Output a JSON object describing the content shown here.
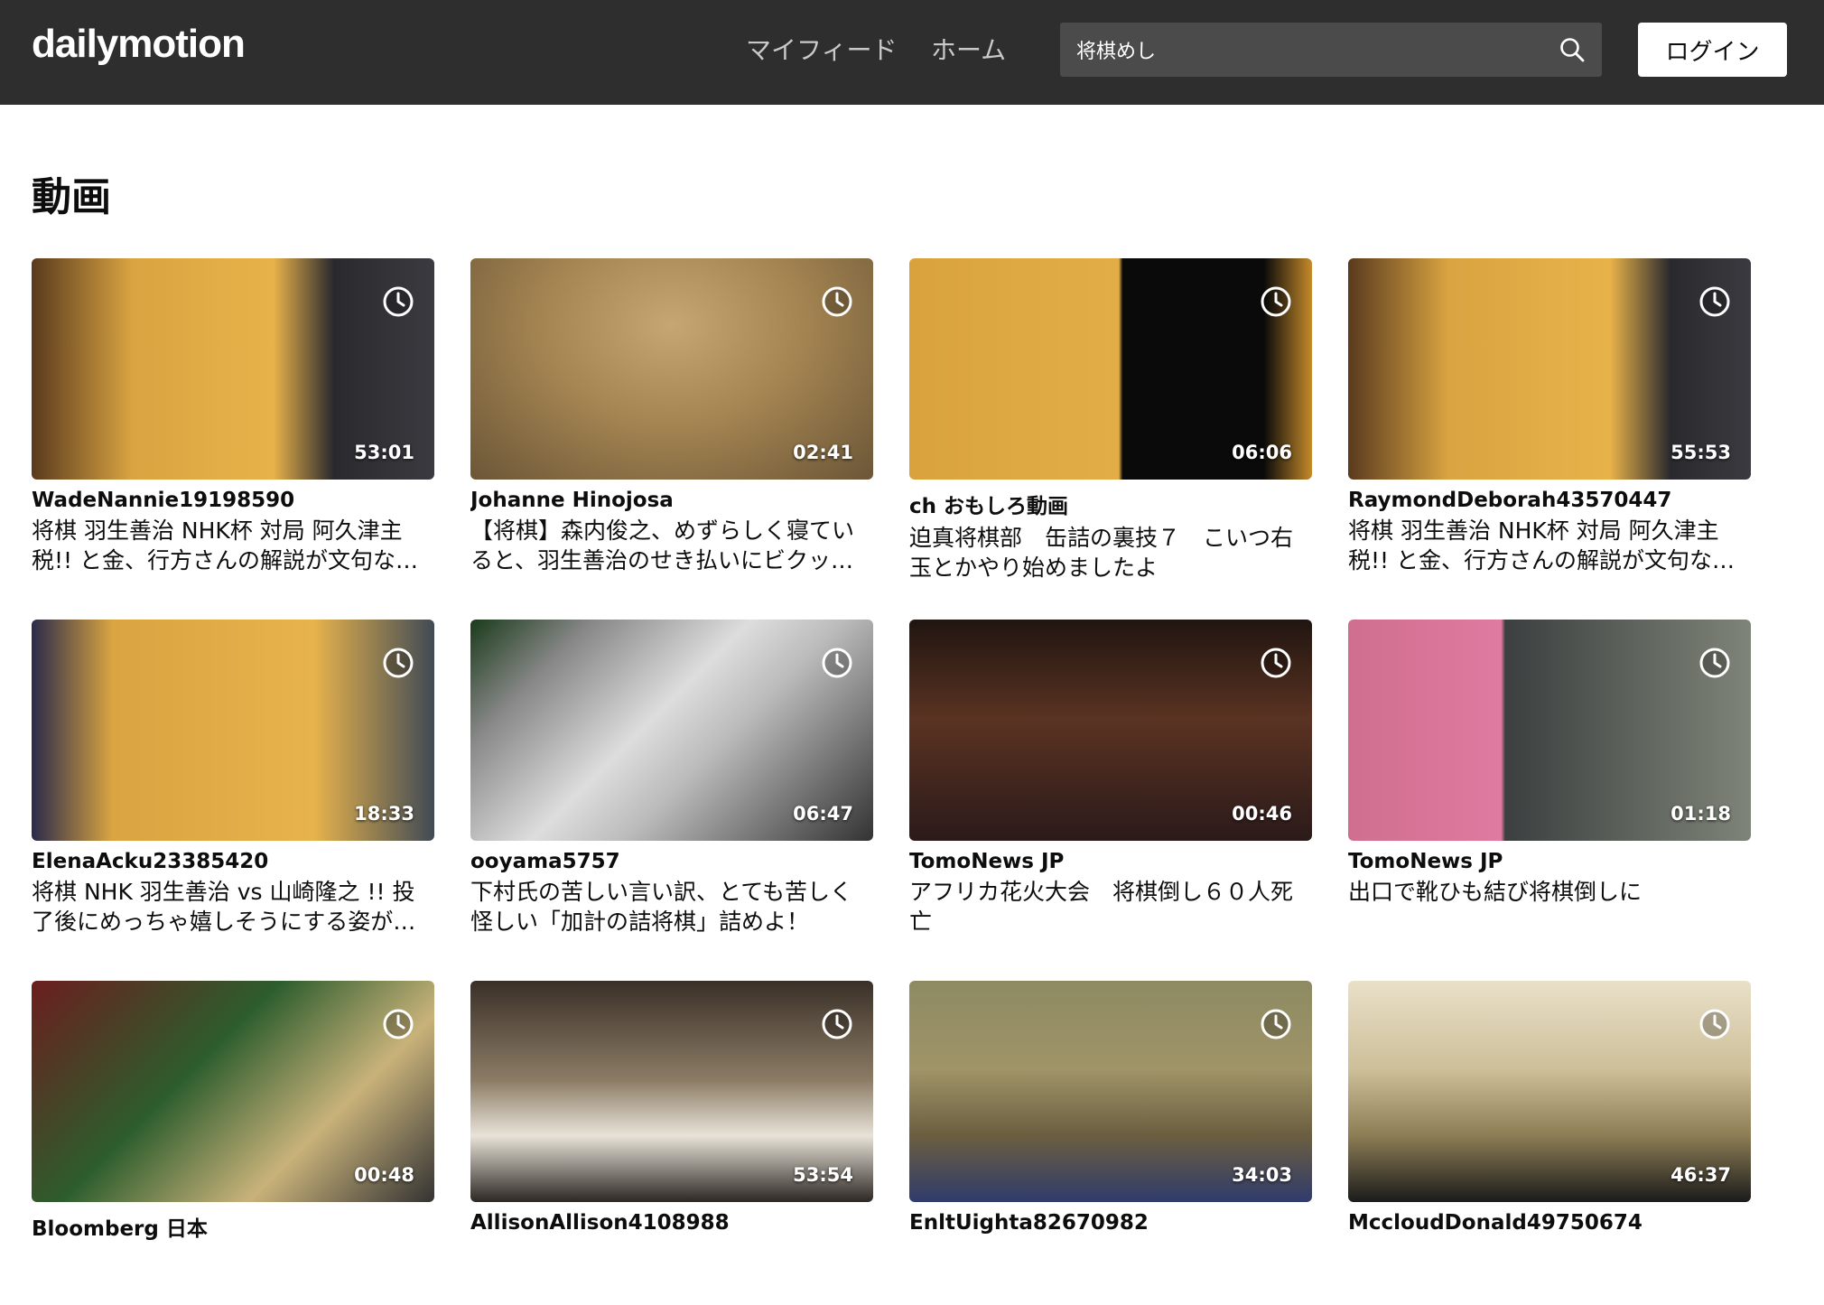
{
  "header": {
    "logo": "dailymotion",
    "nav": {
      "feed": "マイフィード",
      "home": "ホーム"
    },
    "search": {
      "value": "将棋めし"
    },
    "login": "ログイン"
  },
  "section": {
    "title": "動画"
  },
  "videos": [
    {
      "channel": "WadeNannie19198590",
      "title": "将棋 羽生善治 NHK杯 対局 阿久津主税!! と金、行方さんの解説が文句な…",
      "duration": "53:01"
    },
    {
      "channel": "Johanne Hinojosa",
      "title": "【将棋】森内俊之、めずらしく寝ていると、羽生善治のせき払いにビクッ…",
      "duration": "02:41"
    },
    {
      "channel": "ch おもしろ動画",
      "title": "迫真将棋部　缶詰の裏技７　こいつ右玉とかやり始めましたよ",
      "duration": "06:06"
    },
    {
      "channel": "RaymondDeborah43570447",
      "title": "将棋 羽生善治 NHK杯 対局 阿久津主税!! と金、行方さんの解説が文句な…",
      "duration": "55:53"
    },
    {
      "channel": "ElenaAcku23385420",
      "title": "将棋 NHK 羽生善治 vs 山崎隆之 !! 投了後にめっちゃ嬉しそうにする姿が可…",
      "duration": "18:33"
    },
    {
      "channel": "ooyama5757",
      "title": "下村氏の苦しい言い訳、とても苦しく怪しい「加計の詰将棋」詰めよ！",
      "duration": "06:47"
    },
    {
      "channel": "TomoNews JP",
      "title": "アフリカ花火大会　将棋倒し６０人死亡",
      "duration": "00:46"
    },
    {
      "channel": "TomoNews JP",
      "title": "出口で靴ひも結び将棋倒しに",
      "duration": "01:18"
    },
    {
      "channel": "Bloomberg 日本",
      "title": "",
      "duration": "00:48"
    },
    {
      "channel": "AllisonAllison4108988",
      "title": "",
      "duration": "53:54"
    },
    {
      "channel": "EnltUighta82670982",
      "title": "",
      "duration": "34:03"
    },
    {
      "channel": "MccloudDonald49750674",
      "title": "",
      "duration": "46:37"
    }
  ]
}
